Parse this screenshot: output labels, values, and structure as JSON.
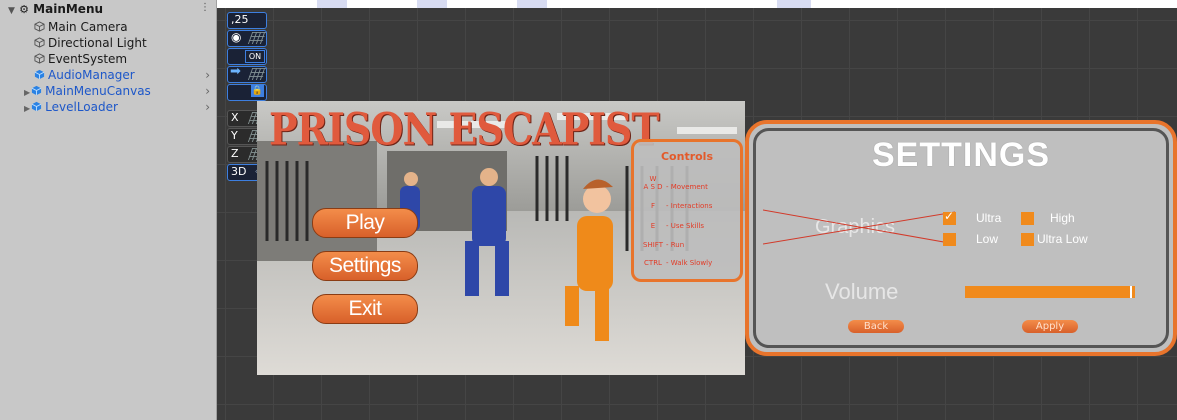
{
  "hierarchy": {
    "scene_name": "MainMenu",
    "items": [
      {
        "label": "Main Camera",
        "prefab": false
      },
      {
        "label": "Directional Light",
        "prefab": false
      },
      {
        "label": "EventSystem",
        "prefab": false
      },
      {
        "label": "AudioManager",
        "prefab": true
      },
      {
        "label": "MainMenuCanvas",
        "prefab": true
      },
      {
        "label": "LevelLoader",
        "prefab": true
      }
    ]
  },
  "overlay_toolbar": {
    "snap_value": ",25",
    "on_label": "ON",
    "x_label": "X",
    "y_label": "Y",
    "z_label": "Z",
    "mode_3d": "3D"
  },
  "game_menu": {
    "title": "PRISON ESCAPIST",
    "buttons": {
      "play": "Play",
      "settings": "Settings",
      "exit": "Exit"
    }
  },
  "controls": {
    "title": "Controls",
    "rows": [
      {
        "key": "W\nA S D",
        "action": "- Movement"
      },
      {
        "key": "F",
        "action": "- Interactions"
      },
      {
        "key": "E",
        "action": "- Use Skills"
      },
      {
        "key": "SHIFT",
        "action": "- Run"
      },
      {
        "key": "CTRL",
        "action": "- Walk Slowly"
      }
    ]
  },
  "settings": {
    "title": "SETTINGS",
    "graphics_label": "Graphics",
    "options": {
      "ultra": "Ultra",
      "high": "High",
      "low": "Low",
      "ultra_low": "Ultra Low"
    },
    "volume_label": "Volume",
    "back_label": "Back",
    "apply_label": "Apply",
    "volume_level": 0.97
  },
  "colors": {
    "accent_orange": "#e8742c",
    "prefab_blue": "#1d57c9"
  }
}
